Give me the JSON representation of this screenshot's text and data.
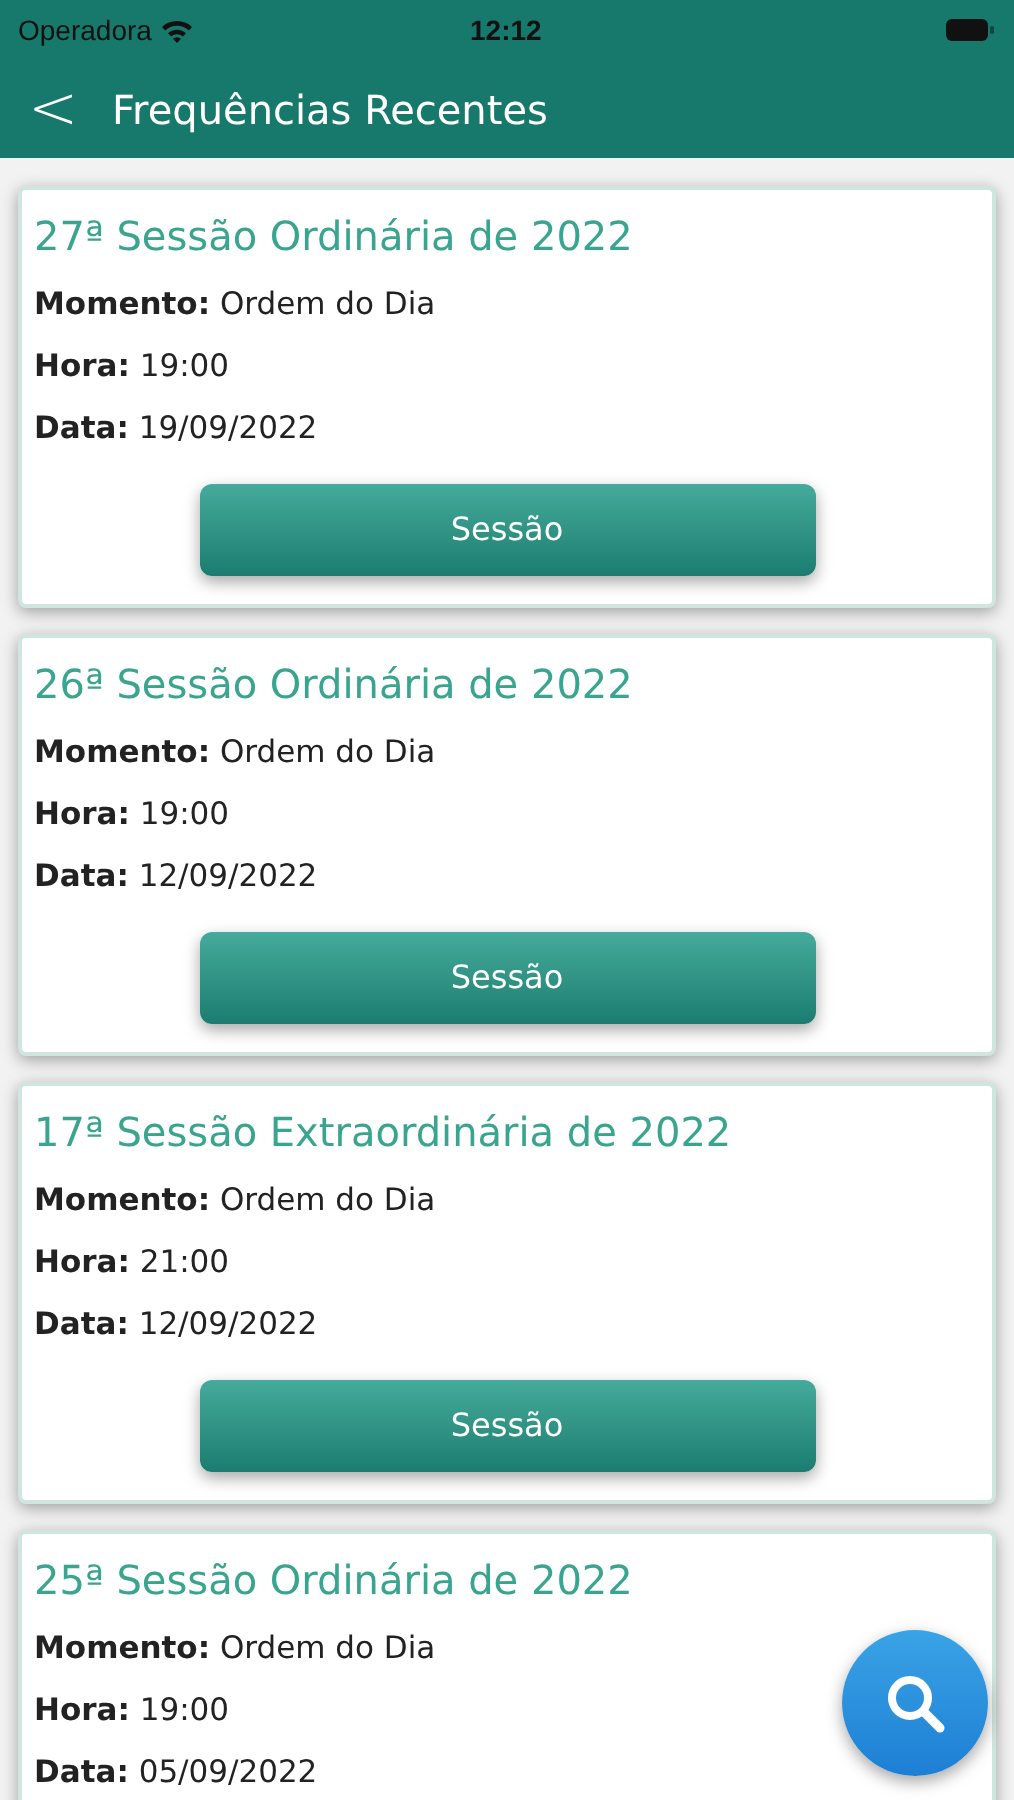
{
  "status_bar": {
    "carrier": "Operadora",
    "time": "12:12"
  },
  "header": {
    "back": "<",
    "title": "Frequências Recentes"
  },
  "sessions": [
    {
      "title": "27ª Sessão Ordinária de 2022",
      "lines": [
        "**Momento:** Ordem do Dia",
        "**Hora:** 19:00",
        "**Data:** 19/09/2022"
      ],
      "button": "Sessão"
    },
    {
      "title": "26ª Sessão Ordinária de 2022",
      "lines": [
        "**Momento:** Ordem do Dia",
        "**Hora:** 19:00",
        "**Data:** 12/09/2022"
      ],
      "button": "Sessão"
    },
    {
      "title": "17ª Sessão Extraordinária de 2022",
      "lines": [
        "**Momento:** Ordem do Dia",
        "**Hora:** 21:00",
        "**Data:** 12/09/2022"
      ],
      "button": "Sessão"
    },
    {
      "title": "25ª Sessão Ordinária de 2022",
      "lines": [
        "**Momento:** Ordem do Dia",
        "**Hora:** 19:00",
        "**Data:** 05/09/2022"
      ]
    }
  ]
}
